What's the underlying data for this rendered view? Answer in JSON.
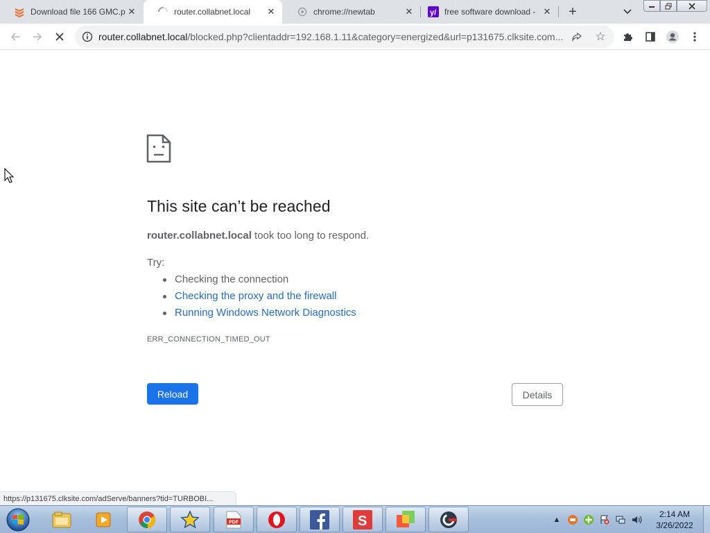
{
  "browser": {
    "tabs": [
      {
        "title": "Download file 166 GMC.p",
        "favicon": "download-stack-icon",
        "active": false
      },
      {
        "title": "router.collabnet.local",
        "favicon": "loading-spinner-icon",
        "active": true
      },
      {
        "title": "chrome://newtab",
        "favicon": "chrome-newtab-icon",
        "active": false
      },
      {
        "title": "free software download -",
        "favicon": "yahoo-icon",
        "active": false
      }
    ],
    "omnibox": {
      "host": "router.collabnet.local",
      "path": "/blocked.php?clientaddr=192.168.1.11&category=energized&url=p131675.clksite.com..."
    },
    "status_url": "https://p131675.clksite.com/adServe/banners?tid=TURBOBI..."
  },
  "error_page": {
    "heading": "This site can’t be reached",
    "host": "router.collabnet.local",
    "message": " took too long to respond.",
    "try_label": "Try:",
    "suggestions": [
      {
        "text": "Checking the connection",
        "link": false
      },
      {
        "text": "Checking the proxy and the firewall",
        "link": true
      },
      {
        "text": "Running Windows Network Diagnostics",
        "link": true
      }
    ],
    "error_code": "ERR_CONNECTION_TIMED_OUT",
    "reload_label": "Reload",
    "details_label": "Details"
  },
  "taskbar": {
    "items": [
      "explorer-icon",
      "media-player-icon",
      "chrome-icon",
      "star-app-icon",
      "pdf-icon",
      "opera-icon",
      "facebook-icon",
      "s-app-icon",
      "colorful-app-icon",
      "ccleaner-icon"
    ],
    "clock_time": "2:14 AM",
    "clock_date": "3/26/2022"
  },
  "colors": {
    "accent": "#1a73e8",
    "link": "#2b6cb3",
    "tabstrip": "#dee1e6",
    "text_secondary": "#5f6368"
  }
}
